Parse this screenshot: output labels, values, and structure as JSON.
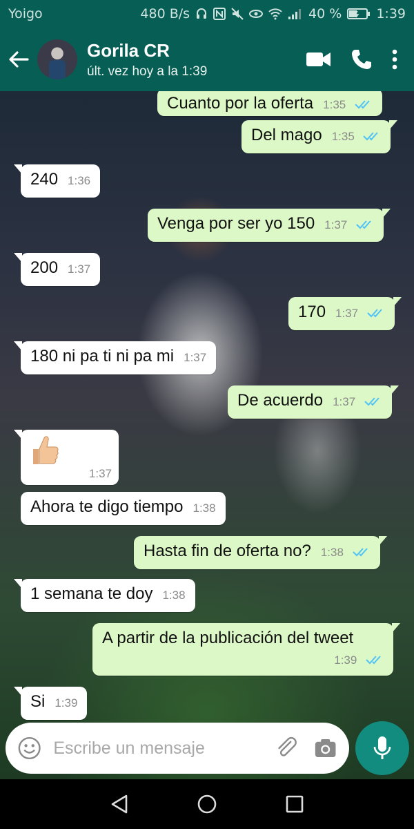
{
  "status_bar": {
    "carrier": "Yoigo",
    "net_speed": "480 B/s",
    "battery": "40 %",
    "time": "1:39"
  },
  "header": {
    "contact_name": "Gorila CR",
    "last_seen": "últ. vez hoy a la 1:39"
  },
  "messages": [
    {
      "dir": "out",
      "text": "Cuanto por la oferta",
      "time": "1:35",
      "read": true
    },
    {
      "dir": "out",
      "text": "Del mago",
      "time": "1:35",
      "read": true
    },
    {
      "dir": "in",
      "text": "240",
      "time": "1:36"
    },
    {
      "dir": "out",
      "text": "Venga por ser yo 150",
      "time": "1:37",
      "read": true
    },
    {
      "dir": "in",
      "text": "200",
      "time": "1:37"
    },
    {
      "dir": "out",
      "text": "170",
      "time": "1:37",
      "read": true
    },
    {
      "dir": "in",
      "text": "180 ni pa ti ni pa mi",
      "time": "1:37"
    },
    {
      "dir": "out",
      "text": "De acuerdo",
      "time": "1:37",
      "read": true
    },
    {
      "dir": "in",
      "emoji": "thumbs-up",
      "time": "1:37"
    },
    {
      "dir": "in",
      "text": "Ahora te digo tiempo",
      "time": "1:38"
    },
    {
      "dir": "out",
      "text": "Hasta fin de oferta no?",
      "time": "1:38",
      "read": true
    },
    {
      "dir": "in",
      "text": "1 semana te doy",
      "time": "1:38"
    },
    {
      "dir": "out",
      "text": "A partir de la publicación del tweet",
      "time": "1:39",
      "read": true
    },
    {
      "dir": "in",
      "text": "Si",
      "time": "1:39"
    }
  ],
  "composer": {
    "placeholder": "Escribe un mensaje"
  },
  "colors": {
    "header": "#075e54",
    "outgoing_bubble": "#dcf8c6",
    "incoming_bubble": "#ffffff",
    "read_ticks": "#4fc3f7",
    "mic_button": "#128c7e"
  }
}
